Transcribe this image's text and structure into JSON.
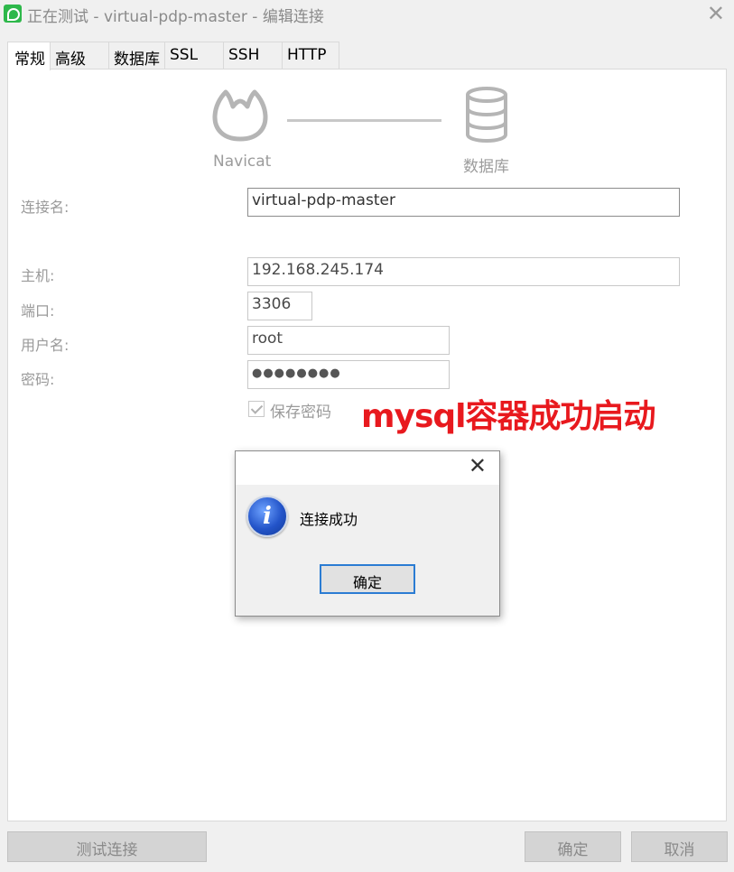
{
  "window": {
    "title": "正在测试 - virtual-pdp-master - 编辑连接",
    "close_glyph": "✕"
  },
  "tabs": [
    {
      "label": "常规",
      "active": true
    },
    {
      "label": "高级"
    },
    {
      "label": "数据库"
    },
    {
      "label": "SSL"
    },
    {
      "label": "SSH"
    },
    {
      "label": "HTTP"
    }
  ],
  "diagram": {
    "left_label": "Navicat",
    "right_label": "数据库",
    "left_icon": "navicat-logo-icon",
    "right_icon": "database-icon"
  },
  "form": {
    "connection_name": {
      "label": "连接名:",
      "value": "virtual-pdp-master"
    },
    "host": {
      "label": "主机:",
      "value": "192.168.245.174"
    },
    "port": {
      "label": "端口:",
      "value": "3306"
    },
    "username": {
      "label": "用户名:",
      "value": "root"
    },
    "password": {
      "label": "密码:",
      "value": "●●●●●●●●"
    },
    "save_password": {
      "label": "保存密码",
      "checked": true
    }
  },
  "annotation": {
    "text": "mysql容器成功启动",
    "color": "#e8191e"
  },
  "dialog": {
    "close_glyph": "✕",
    "icon": "info-icon",
    "icon_glyph": "i",
    "message": "连接成功",
    "ok_label": "确定"
  },
  "footer": {
    "test_label": "测试连接",
    "ok_label": "确定",
    "cancel_label": "取消"
  }
}
